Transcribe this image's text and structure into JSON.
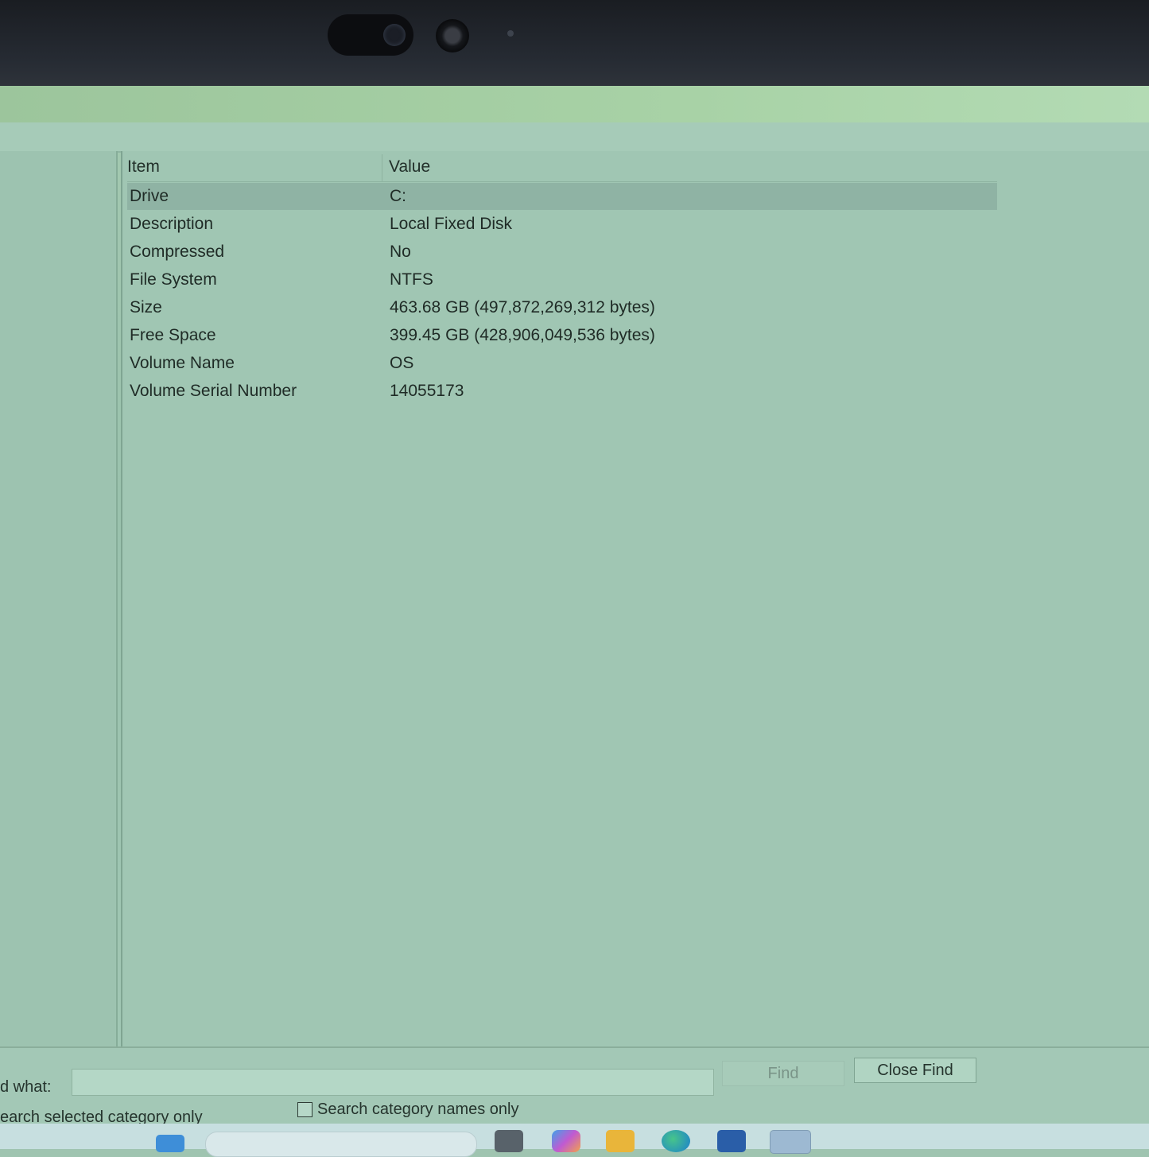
{
  "table": {
    "headers": {
      "item": "Item",
      "value": "Value"
    },
    "rows": [
      {
        "item": "Drive",
        "value": "C:"
      },
      {
        "item": "Description",
        "value": "Local Fixed Disk"
      },
      {
        "item": "Compressed",
        "value": "No"
      },
      {
        "item": "File System",
        "value": "NTFS"
      },
      {
        "item": "Size",
        "value": "463.68 GB (497,872,269,312 bytes)"
      },
      {
        "item": "Free Space",
        "value": "399.45 GB (428,906,049,536 bytes)"
      },
      {
        "item": "Volume Name",
        "value": "OS"
      },
      {
        "item": "Volume Serial Number",
        "value": "14055173"
      }
    ]
  },
  "find_bar": {
    "label": "d what:",
    "find_button": "Find",
    "close_find_button": "Close Find",
    "search_selected_category_only": "earch selected category only",
    "search_category_names_only": "Search category names only"
  },
  "taskbar": {
    "icons": [
      "windows-start-icon",
      "search-box",
      "file-explorer-icon",
      "copilot-icon",
      "folder-icon",
      "edge-icon",
      "store-icon",
      "system-information-icon"
    ]
  }
}
